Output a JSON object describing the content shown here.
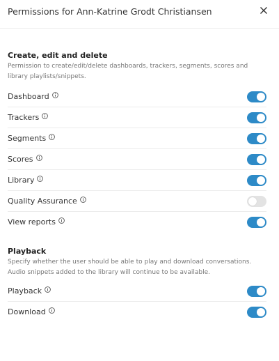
{
  "dialog": {
    "title": "Permissions for Ann-Katrine Grodt Christiansen"
  },
  "sections": [
    {
      "title": "Create, edit and delete",
      "description": "Permission to create/edit/delete dashboards, trackers, segments, scores and library playlists/snippets.",
      "items": [
        {
          "label": "Dashboard",
          "enabled": true
        },
        {
          "label": "Trackers",
          "enabled": true
        },
        {
          "label": "Segments",
          "enabled": true
        },
        {
          "label": "Scores",
          "enabled": true
        },
        {
          "label": "Library",
          "enabled": true
        },
        {
          "label": "Quality Assurance",
          "enabled": false
        },
        {
          "label": "View reports",
          "enabled": true
        }
      ]
    },
    {
      "title": "Playback",
      "description": "Specify whether the user should be able to play and download conversations. Audio snippets added to the library will continue to be available.",
      "items": [
        {
          "label": "Playback",
          "enabled": true
        },
        {
          "label": "Download",
          "enabled": true
        }
      ]
    }
  ],
  "colors": {
    "toggle_on": "#2d8ac7",
    "toggle_off": "#e3e3e3"
  },
  "icons": {
    "close": "close-icon",
    "info": "info-icon"
  }
}
